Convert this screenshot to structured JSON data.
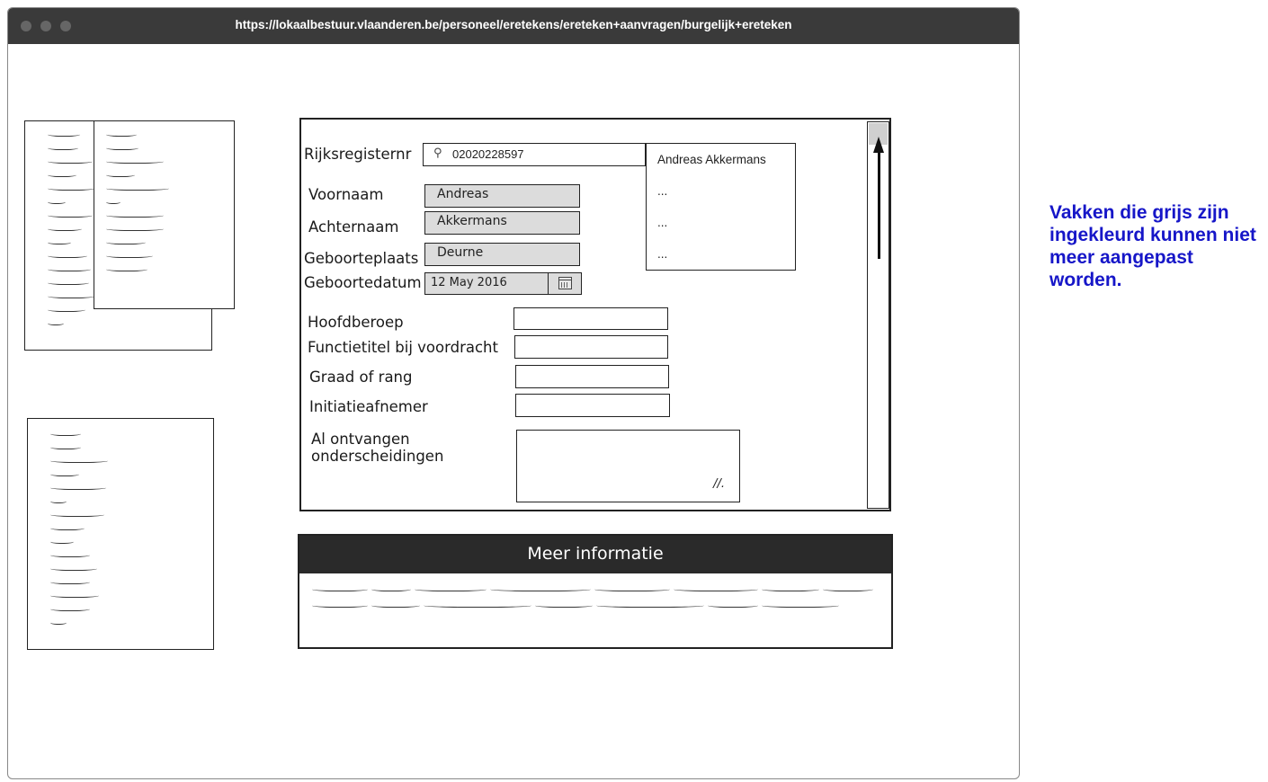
{
  "browser": {
    "url": "https://lokaalbestuur.vlaanderen.be/personeel/eretekens/ereteken+aanvragen/burgelijk+ereteken"
  },
  "form": {
    "rijksregister": {
      "label": "Rijksregisternr",
      "value": "02020228597"
    },
    "voornaam": {
      "label": "Voornaam",
      "value": "Andreas"
    },
    "achternaam": {
      "label": "Achternaam",
      "value": "Akkermans"
    },
    "geboorteplaats": {
      "label": "Geboorteplaats",
      "value": "Deurne"
    },
    "geboortedatum": {
      "label": "Geboortedatum",
      "value": "12 May 2016"
    },
    "hoofdberoep": {
      "label": "Hoofdberoep",
      "value": ""
    },
    "functietitel": {
      "label": "Functietitel bij voordracht",
      "value": ""
    },
    "graad": {
      "label": "Graad of rang",
      "value": ""
    },
    "initiatiefnemer": {
      "label": "Initiatieafnemer",
      "value": ""
    },
    "onderscheidingen": {
      "label_line1": "Al ontvangen",
      "label_line2": "onderscheidingen",
      "value": ""
    }
  },
  "suggestions": {
    "items": [
      "Andreas Akkermans",
      "...",
      "...",
      "..."
    ]
  },
  "info_panel": {
    "title": "Meer informatie"
  },
  "note": {
    "text": "Vakken die grijs zijn ingekleurd kunnen niet meer aangepast worden."
  },
  "colors": {
    "note_text": "#1616c8",
    "titlebar": "#3a3a3a",
    "readonly_field": "#dcdcdc",
    "info_header": "#2a2a2a"
  },
  "icons": {
    "search": "search-icon",
    "calendar": "calendar-icon",
    "resize": "resize-grip-icon",
    "scroll_up": "arrow-up-icon"
  }
}
